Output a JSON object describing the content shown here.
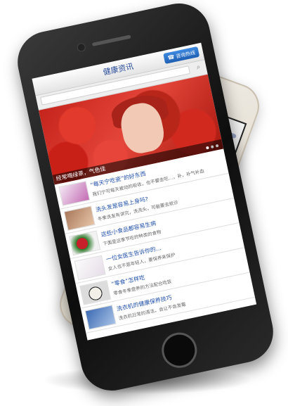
{
  "header": {
    "title": "健康资讯",
    "hotline_label": "咨询热线"
  },
  "search": {
    "placeholder": ""
  },
  "banner": {
    "caption": "经常喝绿茶，气色佳"
  },
  "articles": [
    {
      "title": "“每天宁吃瓷”的好东西",
      "desc": "我们宁可每天被动的吸收，也不要去吃…，补，补气补血"
    },
    {
      "title": "洗头发是容易上身吗?",
      "desc": "冬季洗发有讲究，洗洗头，可能要去就诊"
    },
    {
      "title": "这些小食品都容易生病",
      "desc": "下面是这季节吃的种类的食物"
    },
    {
      "title": "一位女医生告诉你的…",
      "desc": "女人也不是年轻人，要保养来保护"
    },
    {
      "title": "“零食”怎样吃",
      "desc": "零食冬季营养的方法配合吃饭"
    },
    {
      "title": "洗衣机的健康保养技巧",
      "desc": "洗衣机日常的清洁，会让不会发霉"
    }
  ],
  "colors": {
    "accent": "#1f5fb3",
    "link": "#1f4fa8"
  },
  "icons": {
    "search": "search-icon",
    "phone": "phone-icon"
  }
}
